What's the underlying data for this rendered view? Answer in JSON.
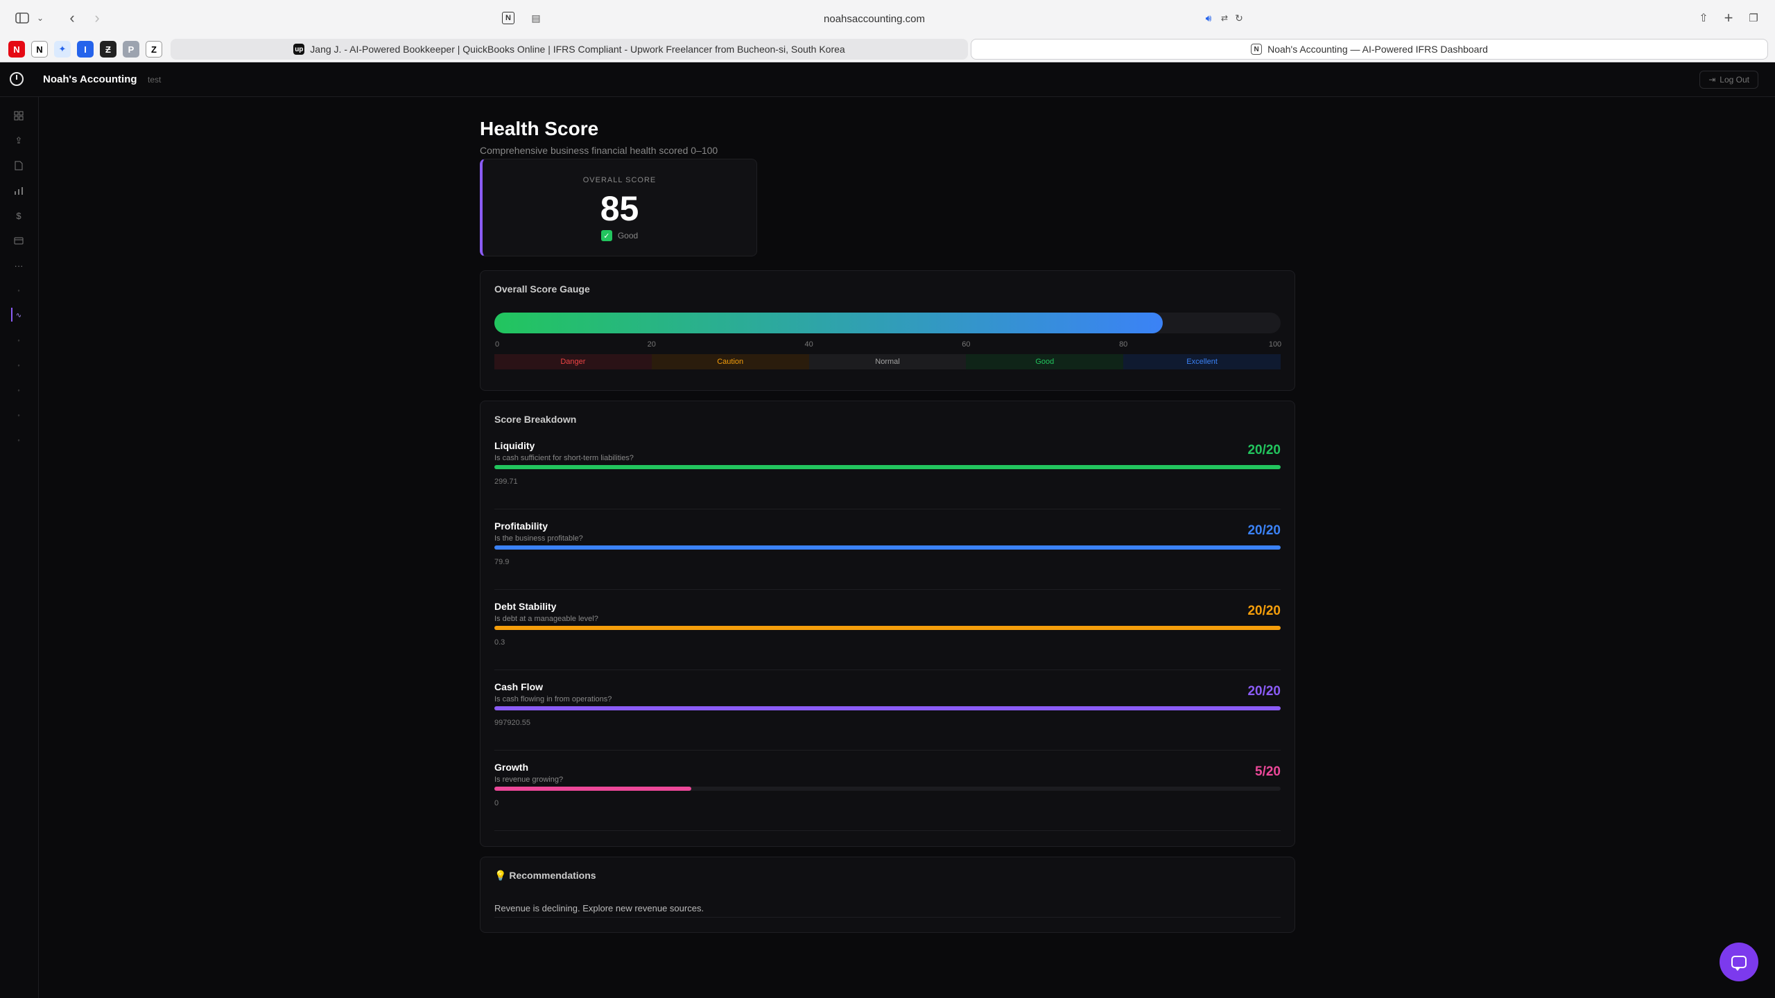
{
  "browser": {
    "url": "noahsaccounting.com",
    "tabs": [
      {
        "title": "Jang J. - AI-Powered Bookkeeper | QuickBooks Online | IFRS Compliant - Upwork Freelancer from Bucheon-si, South Korea",
        "active": false
      },
      {
        "title": "Noah's Accounting — AI-Powered IFRS Dashboard",
        "active": true
      }
    ],
    "pinned_tabs": [
      "N",
      "N",
      "✦",
      "I",
      "Ƶ",
      "P",
      "Z"
    ]
  },
  "header": {
    "app_name": "Noah's Accounting",
    "workspace": "test",
    "logout_label": "Log Out"
  },
  "page": {
    "title": "Health Score",
    "subtitle": "Comprehensive business financial health scored 0–100"
  },
  "overall": {
    "label": "OVERALL SCORE",
    "score": "85",
    "status": "Good"
  },
  "gauge": {
    "title": "Overall Score Gauge",
    "value": 85,
    "ticks": [
      "0",
      "20",
      "40",
      "60",
      "80",
      "100"
    ],
    "zones": [
      {
        "label": "Danger",
        "color": "#ef4444",
        "bg": "#2a1216"
      },
      {
        "label": "Caution",
        "color": "#f59e0b",
        "bg": "#2a1c0c"
      },
      {
        "label": "Normal",
        "color": "#a3a3a3",
        "bg": "#1c1c1f"
      },
      {
        "label": "Good",
        "color": "#22c55e",
        "bg": "#0f2418"
      },
      {
        "label": "Excellent",
        "color": "#3b82f6",
        "bg": "#0f1a30"
      }
    ]
  },
  "breakdown": {
    "title": "Score Breakdown",
    "items": [
      {
        "name": "Liquidity",
        "question": "Is cash sufficient for short-term liabilities?",
        "score": "20/20",
        "fraction": 1.0,
        "value": "299.71",
        "color": "#22c55e"
      },
      {
        "name": "Profitability",
        "question": "Is the business profitable?",
        "score": "20/20",
        "fraction": 1.0,
        "value": "79.9",
        "color": "#3b82f6"
      },
      {
        "name": "Debt Stability",
        "question": "Is debt at a manageable level?",
        "score": "20/20",
        "fraction": 1.0,
        "value": "0.3",
        "color": "#f59e0b"
      },
      {
        "name": "Cash Flow",
        "question": "Is cash flowing in from operations?",
        "score": "20/20",
        "fraction": 1.0,
        "value": "997920.55",
        "color": "#8b5cf6"
      },
      {
        "name": "Growth",
        "question": "Is revenue growing?",
        "score": "5/20",
        "fraction": 0.25,
        "value": "0",
        "color": "#ec4899"
      }
    ]
  },
  "recommendations": {
    "icon": "💡",
    "title": "Recommendations",
    "items": [
      "Revenue is declining. Explore new revenue sources."
    ]
  }
}
